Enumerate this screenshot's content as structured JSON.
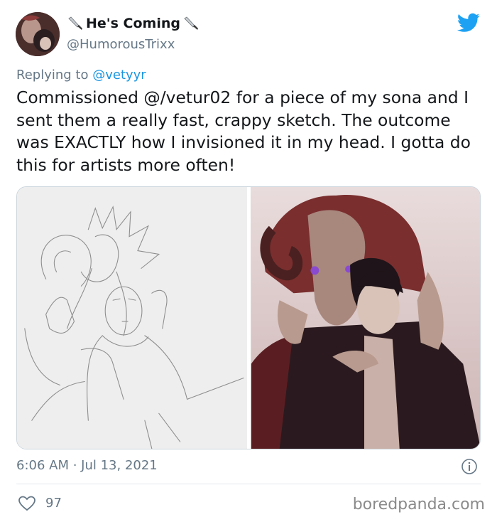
{
  "user": {
    "display_name": "He's Coming",
    "handle": "@HumorousTrixx",
    "name_emoji": "knife-icon"
  },
  "reply": {
    "prefix": "Replying to",
    "mention": "@vetyyr"
  },
  "tweet": {
    "text": "Commissioned @/vetur02 for a piece of my sona and I sent them a really fast, crappy sketch. The outcome was EXACTLY how I invisioned it in my head. I gotta do this for artists more often!",
    "timestamp": "6:06 AM · Jul 13, 2021",
    "likes": "97"
  },
  "media": {
    "left_image": "pencil sketch",
    "right_image": "finished colored artwork"
  },
  "watermark": "boredpanda.com",
  "colors": {
    "twitter_blue": "#1da1f2",
    "secondary_text": "#657786",
    "link": "#1b95e0"
  }
}
